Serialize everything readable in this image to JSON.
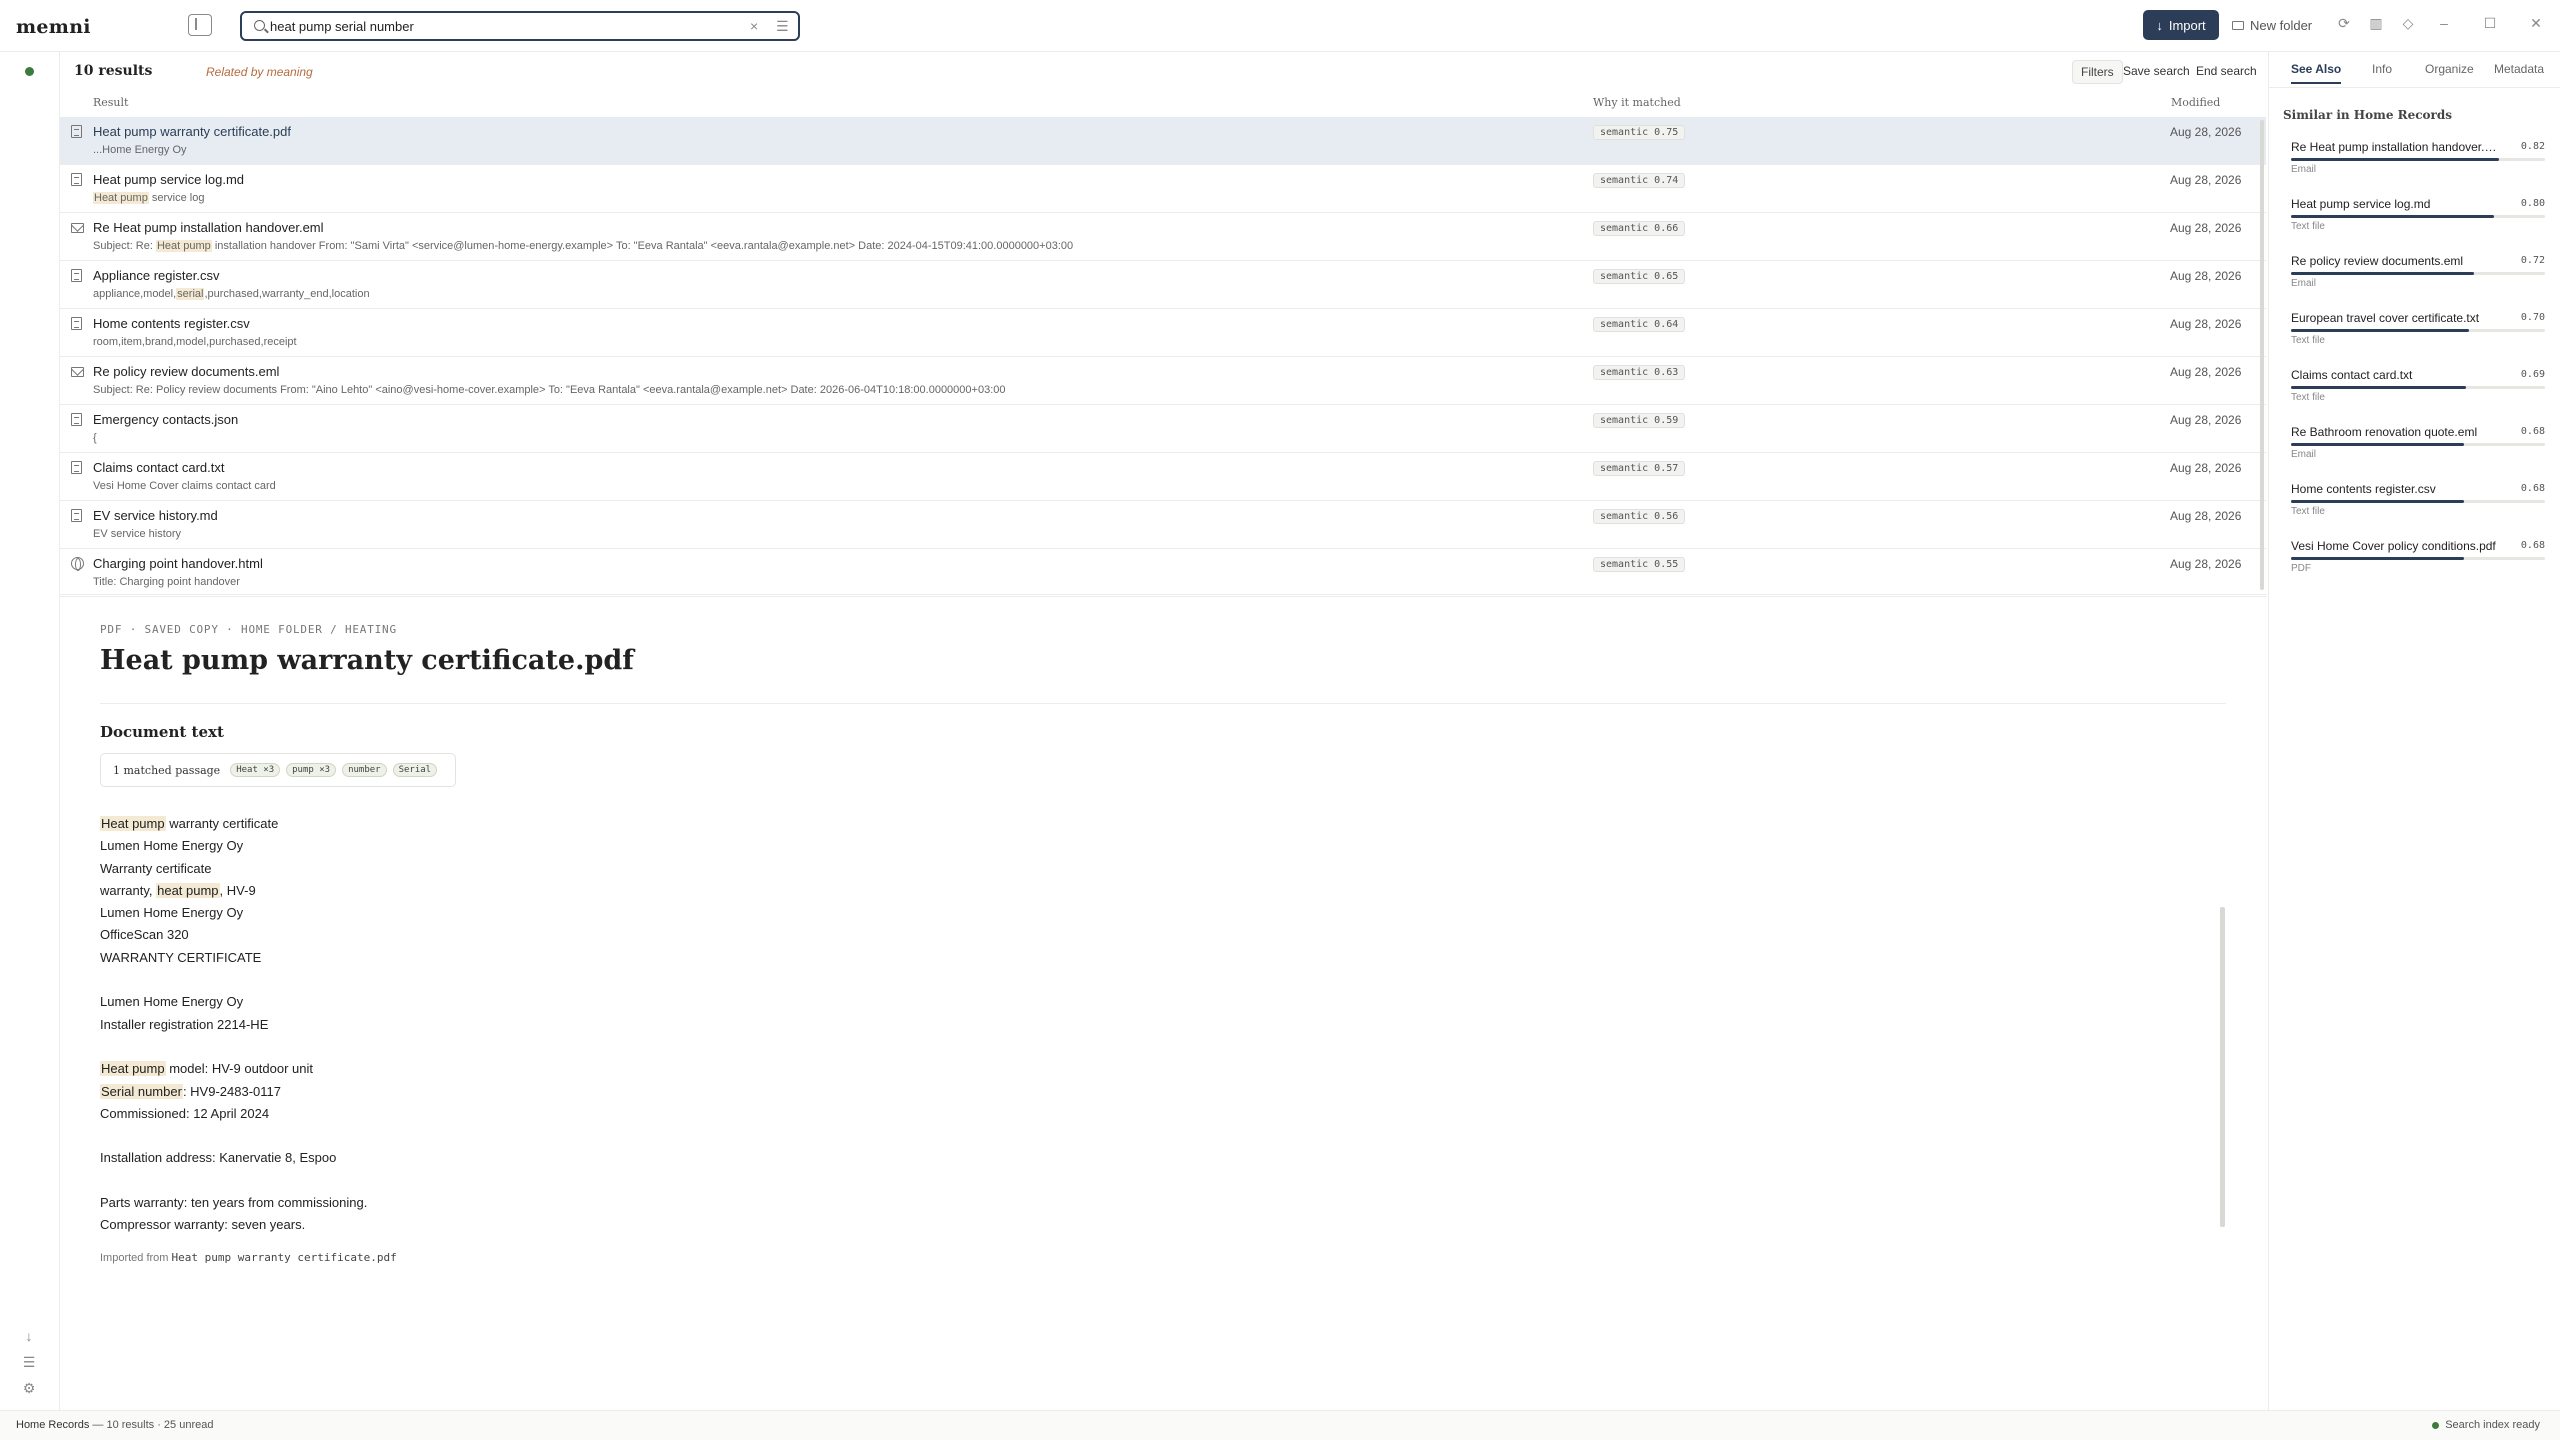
{
  "app": {
    "logo": "memni"
  },
  "search": {
    "query": "heat pump serial number",
    "clear_glyph": "×",
    "menu_glyph": "☰"
  },
  "toolbar": {
    "import_label": "Import",
    "import_glyph": "↓",
    "new_folder_label": "New folder"
  },
  "results_header": {
    "count": "10 results",
    "mode": "Related by meaning",
    "filters": "Filters",
    "save_search": "Save search",
    "end_search": "End search"
  },
  "columns": {
    "result": "Result",
    "why": "Why it matched",
    "modified": "Modified"
  },
  "results": [
    {
      "title": "Heat pump warranty certificate.pdf",
      "icon": "document-icon",
      "snippet": "...Home Energy Oy",
      "badge": "semantic 0.75",
      "date": "Aug 28, 2026",
      "selected": true
    },
    {
      "title": "Heat pump service log.md",
      "icon": "document-icon",
      "snippet_hl": "Heat pump",
      "snippet_rest": " service log",
      "badge": "semantic 0.74",
      "date": "Aug 28, 2026"
    },
    {
      "title": "Re Heat pump installation handover.eml",
      "icon": "mail-icon",
      "snippet_pre": "Subject: Re: ",
      "snippet_hl": "Heat pump",
      "snippet_rest": " installation handover From: \"Sami Virta\" <service@lumen-home-energy.example> To: \"Eeva Rantala\" <eeva.rantala@example.net> Date: 2024-04-15T09:41:00.0000000+03:00",
      "badge": "semantic 0.66",
      "date": "Aug 28, 2026"
    },
    {
      "title": "Appliance register.csv",
      "icon": "document-icon",
      "snippet_pre": "appliance,model,",
      "snippet_hl": "serial",
      "snippet_rest": ",purchased,warranty_end,location",
      "badge": "semantic 0.65",
      "date": "Aug 28, 2026"
    },
    {
      "title": "Home contents register.csv",
      "icon": "document-icon",
      "snippet": "room,item,brand,model,purchased,receipt",
      "badge": "semantic 0.64",
      "date": "Aug 28, 2026"
    },
    {
      "title": "Re policy review documents.eml",
      "icon": "mail-icon",
      "snippet": "Subject: Re: Policy review documents From: \"Aino Lehto\" <aino@vesi-home-cover.example> To: \"Eeva Rantala\" <eeva.rantala@example.net> Date: 2026-06-04T10:18:00.0000000+03:00",
      "badge": "semantic 0.63",
      "date": "Aug 28, 2026"
    },
    {
      "title": "Emergency contacts.json",
      "icon": "document-icon",
      "snippet": "{",
      "badge": "semantic 0.59",
      "date": "Aug 28, 2026"
    },
    {
      "title": "Claims contact card.txt",
      "icon": "document-icon",
      "snippet": "Vesi Home Cover claims contact card",
      "badge": "semantic 0.57",
      "date": "Aug 28, 2026"
    },
    {
      "title": "EV service history.md",
      "icon": "document-icon",
      "snippet": "EV service history",
      "badge": "semantic 0.56",
      "date": "Aug 28, 2026"
    },
    {
      "title": "Charging point handover.html",
      "icon": "globe-icon",
      "snippet": "Title: Charging point handover",
      "badge": "semantic 0.55",
      "date": "Aug 28, 2026"
    }
  ],
  "preview": {
    "breadcrumb": "PDF · SAVED COPY · HOME FOLDER / HEATING",
    "title": "Heat pump warranty certificate.pdf",
    "section": "Document text",
    "passage_label": "1 matched passage",
    "chips": [
      "Heat ×3",
      "pump ×3",
      "number",
      "Serial"
    ],
    "lines": [
      {
        "hl": "Heat pump",
        "rest": " warranty certificate"
      },
      {
        "rest": "Lumen Home Energy Oy"
      },
      {
        "rest": "Warranty certificate"
      },
      {
        "pre": "warranty, ",
        "hl": "heat pump",
        "rest": ", HV-9"
      },
      {
        "rest": "Lumen Home Energy Oy"
      },
      {
        "rest": "OfficeScan 320"
      },
      {
        "rest": "WARRANTY CERTIFICATE"
      },
      {
        "rest": ""
      },
      {
        "rest": "Lumen Home Energy Oy"
      },
      {
        "rest": "Installer registration 2214-HE"
      },
      {
        "rest": ""
      },
      {
        "hl": "Heat pump",
        "rest": " model: HV-9 outdoor unit"
      },
      {
        "hl": "Serial number",
        "rest": ": HV9-2483-0117"
      },
      {
        "rest": "Commissioned: 12 April 2024"
      },
      {
        "rest": ""
      },
      {
        "rest": "Installation address: Kanervatie 8, Espoo"
      },
      {
        "rest": ""
      },
      {
        "rest": "Parts warranty: ten years from commissioning."
      },
      {
        "rest": "Compressor warranty: seven years."
      }
    ],
    "imported_label": "Imported from",
    "imported_file": "Heat pump warranty certificate.pdf"
  },
  "right_panel": {
    "tabs": [
      "See Also",
      "Info",
      "Organize",
      "Metadata"
    ],
    "active_tab": "See Also",
    "section": "Similar in Home Records",
    "items": [
      {
        "title": "Re Heat pump installation handover.eml",
        "score": "0.82",
        "value": 0.82,
        "type": "Email"
      },
      {
        "title": "Heat pump service log.md",
        "score": "0.80",
        "value": 0.8,
        "type": "Text file"
      },
      {
        "title": "Re policy review documents.eml",
        "score": "0.72",
        "value": 0.72,
        "type": "Email"
      },
      {
        "title": "European travel cover certificate.txt",
        "score": "0.70",
        "value": 0.7,
        "type": "Text file"
      },
      {
        "title": "Claims contact card.txt",
        "score": "0.69",
        "value": 0.69,
        "type": "Text file"
      },
      {
        "title": "Re Bathroom renovation quote.eml",
        "score": "0.68",
        "value": 0.68,
        "type": "Email"
      },
      {
        "title": "Home contents register.csv",
        "score": "0.68",
        "value": 0.68,
        "type": "Text file"
      },
      {
        "title": "Vesi Home Cover policy conditions.pdf",
        "score": "0.68",
        "value": 0.68,
        "type": "PDF"
      }
    ]
  },
  "statusbar": {
    "library": "Home Records",
    "summary": " — 10 results · 25 unread",
    "index_status": "Search index ready"
  },
  "colors": {
    "accent": "#2b3d57",
    "highlight": "#f4ead3",
    "status_ok": "#3d7a3d",
    "related": "#b66b3e"
  }
}
